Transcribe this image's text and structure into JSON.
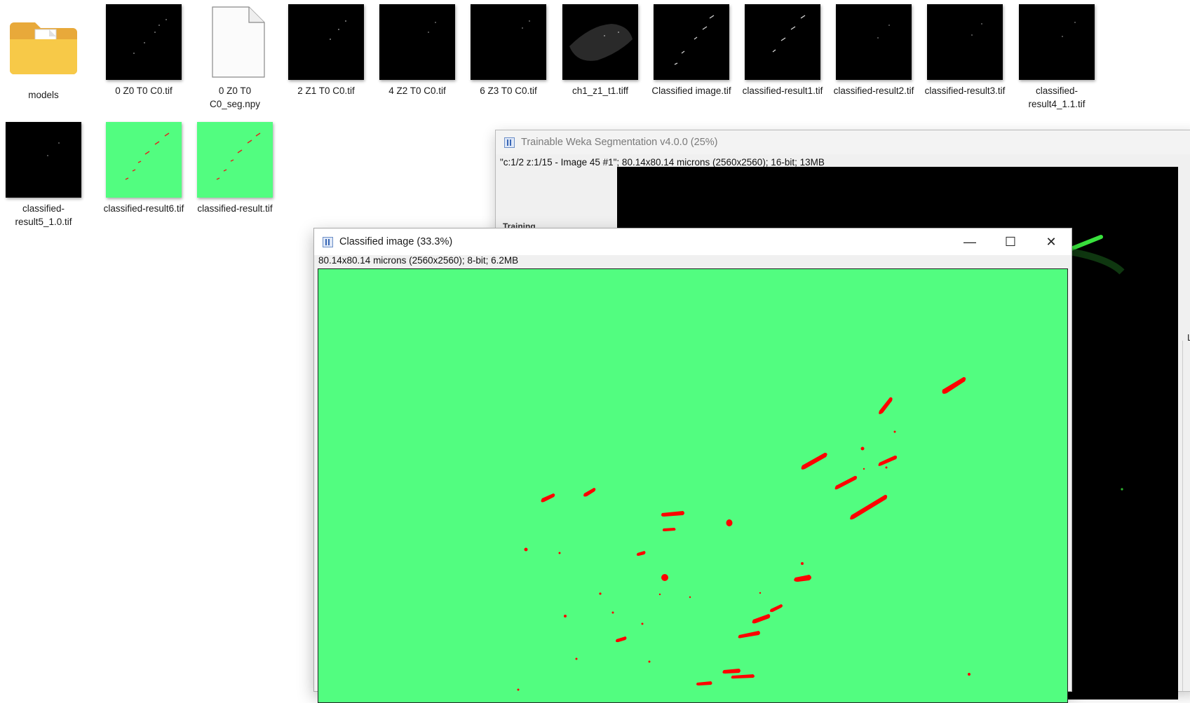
{
  "files_row1": [
    {
      "name": "models",
      "kind": "folder"
    },
    {
      "name": "0 Z0 T0 C0.tif",
      "kind": "black"
    },
    {
      "name": "0 Z0 T0 C0_seg.npy",
      "kind": "doc"
    },
    {
      "name": "2 Z1 T0 C0.tif",
      "kind": "black"
    },
    {
      "name": "4 Z2 T0 C0.tif",
      "kind": "black"
    },
    {
      "name": "6 Z3 T0 C0.tif",
      "kind": "black"
    },
    {
      "name": "ch1_z1_t1.tiff",
      "kind": "black"
    },
    {
      "name": "Classified image.tif",
      "kind": "black"
    },
    {
      "name": "classified-result1.tif",
      "kind": "black"
    },
    {
      "name": "classified-result2.tif",
      "kind": "black"
    },
    {
      "name": "classified-result3.tif",
      "kind": "black"
    },
    {
      "name": "classified-result4_1.1.tif",
      "kind": "black"
    }
  ],
  "files_row2": [
    {
      "name": "classified-result5_1.0.tif",
      "kind": "black"
    },
    {
      "name": "classified-result6.tif",
      "kind": "green"
    },
    {
      "name": "classified-result.tif",
      "kind": "green"
    }
  ],
  "weka_window": {
    "title": "Trainable Weka Segmentation v4.0.0 (25%)",
    "status": "\"c:1/2 z:1/15 - Image 45 #1\"; 80.14x80.14 microns (2560x2560); 16-bit; 13MB",
    "section_label": "Training",
    "right_panel_letter": "L"
  },
  "classified_window": {
    "title": "Classified image (33.3%)",
    "info": "80.14x80.14 microns (2560x2560); 8-bit; 6.2MB",
    "minimize_glyph": "—",
    "maximize_glyph": "☐",
    "close_glyph": "✕"
  },
  "colors": {
    "classified_bg": "#52fd80",
    "segment": "#ff0000",
    "weka_signal": "#39e23d"
  }
}
